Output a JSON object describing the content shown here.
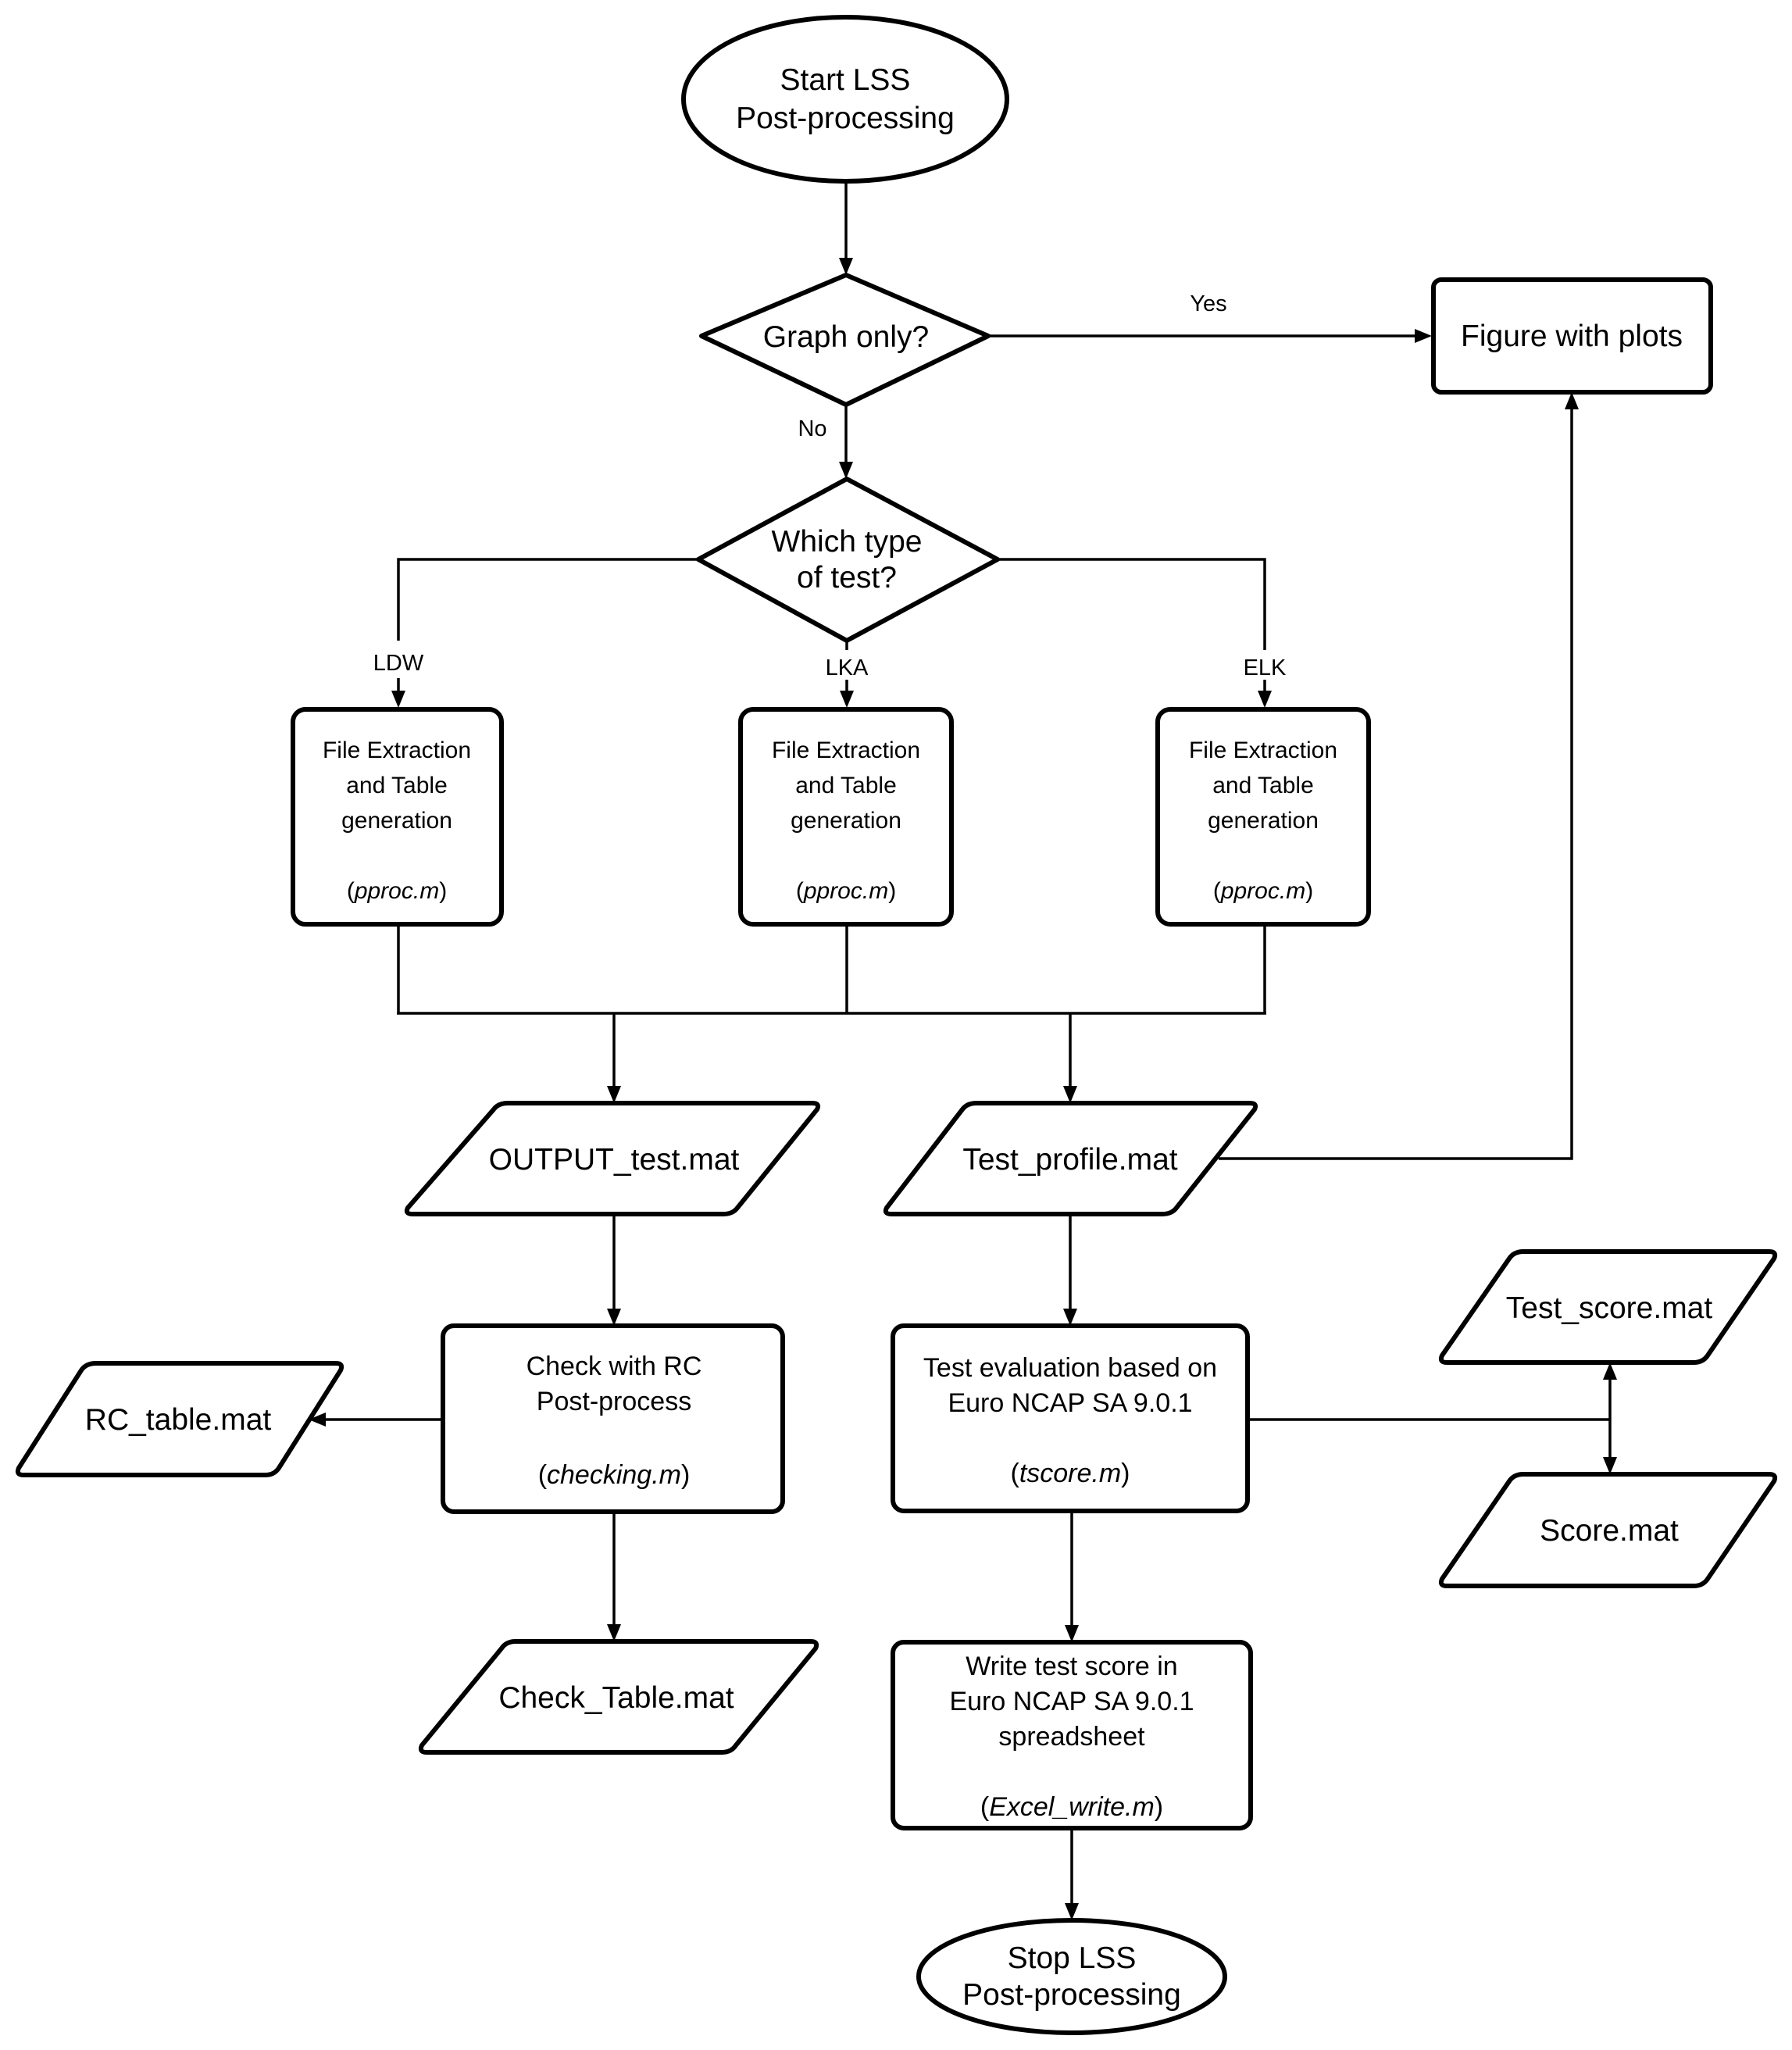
{
  "diagram": {
    "type": "flowchart",
    "nodes": {
      "start": {
        "shape": "terminator",
        "lines": [
          "Start LSS",
          "Post-processing"
        ]
      },
      "graph_only": {
        "shape": "decision",
        "lines": [
          "Graph only?"
        ]
      },
      "figure": {
        "shape": "process",
        "lines": [
          "Figure with plots"
        ]
      },
      "test_type": {
        "shape": "decision",
        "lines": [
          "Which type",
          "of test?"
        ]
      },
      "extract_ldw": {
        "shape": "process",
        "lines": [
          "File Extraction",
          "and Table",
          "generation"
        ],
        "script": "pproc.m"
      },
      "extract_lka": {
        "shape": "process",
        "lines": [
          "File Extraction",
          "and Table",
          "generation"
        ],
        "script": "pproc.m"
      },
      "extract_elk": {
        "shape": "process",
        "lines": [
          "File Extraction",
          "and Table",
          "generation"
        ],
        "script": "pproc.m"
      },
      "output_test": {
        "shape": "data",
        "lines": [
          "OUTPUT_test.mat"
        ]
      },
      "test_profile": {
        "shape": "data",
        "lines": [
          "Test_profile.mat"
        ]
      },
      "check": {
        "shape": "process",
        "lines": [
          "Check with RC",
          "Post-process"
        ],
        "script": "checking.m"
      },
      "rc_table": {
        "shape": "data",
        "lines": [
          "RC_table.mat"
        ]
      },
      "check_table": {
        "shape": "data",
        "lines": [
          "Check_Table.mat"
        ]
      },
      "evaluation": {
        "shape": "process",
        "lines": [
          "Test evaluation based on",
          "Euro NCAP SA 9.0.1"
        ],
        "script": "tscore.m"
      },
      "test_score": {
        "shape": "data",
        "lines": [
          "Test_score.mat"
        ]
      },
      "score": {
        "shape": "data",
        "lines": [
          "Score.mat"
        ]
      },
      "write": {
        "shape": "process",
        "lines": [
          "Write test score in",
          "Euro NCAP SA 9.0.1",
          "spreadsheet"
        ],
        "script": "Excel_write.m"
      },
      "stop": {
        "shape": "terminator",
        "lines": [
          "Stop LSS",
          "Post-processing"
        ]
      }
    },
    "edge_labels": {
      "yes": "Yes",
      "no": "No",
      "ldw": "LDW",
      "lka": "LKA",
      "elk": "ELK"
    },
    "edges": [
      {
        "from": "start",
        "to": "graph_only"
      },
      {
        "from": "graph_only",
        "to": "figure",
        "label": "Yes"
      },
      {
        "from": "graph_only",
        "to": "test_type",
        "label": "No"
      },
      {
        "from": "test_type",
        "to": "extract_ldw",
        "label": "LDW"
      },
      {
        "from": "test_type",
        "to": "extract_lka",
        "label": "LKA"
      },
      {
        "from": "test_type",
        "to": "extract_elk",
        "label": "ELK"
      },
      {
        "from": "extract_*",
        "to": "output_test"
      },
      {
        "from": "extract_*",
        "to": "test_profile"
      },
      {
        "from": "test_profile",
        "to": "figure"
      },
      {
        "from": "output_test",
        "to": "check"
      },
      {
        "from": "check",
        "to": "rc_table"
      },
      {
        "from": "check",
        "to": "check_table"
      },
      {
        "from": "test_profile",
        "to": "evaluation"
      },
      {
        "from": "evaluation",
        "to": "test_score"
      },
      {
        "from": "evaluation",
        "to": "score"
      },
      {
        "from": "evaluation",
        "to": "write"
      },
      {
        "from": "write",
        "to": "stop"
      }
    ]
  }
}
